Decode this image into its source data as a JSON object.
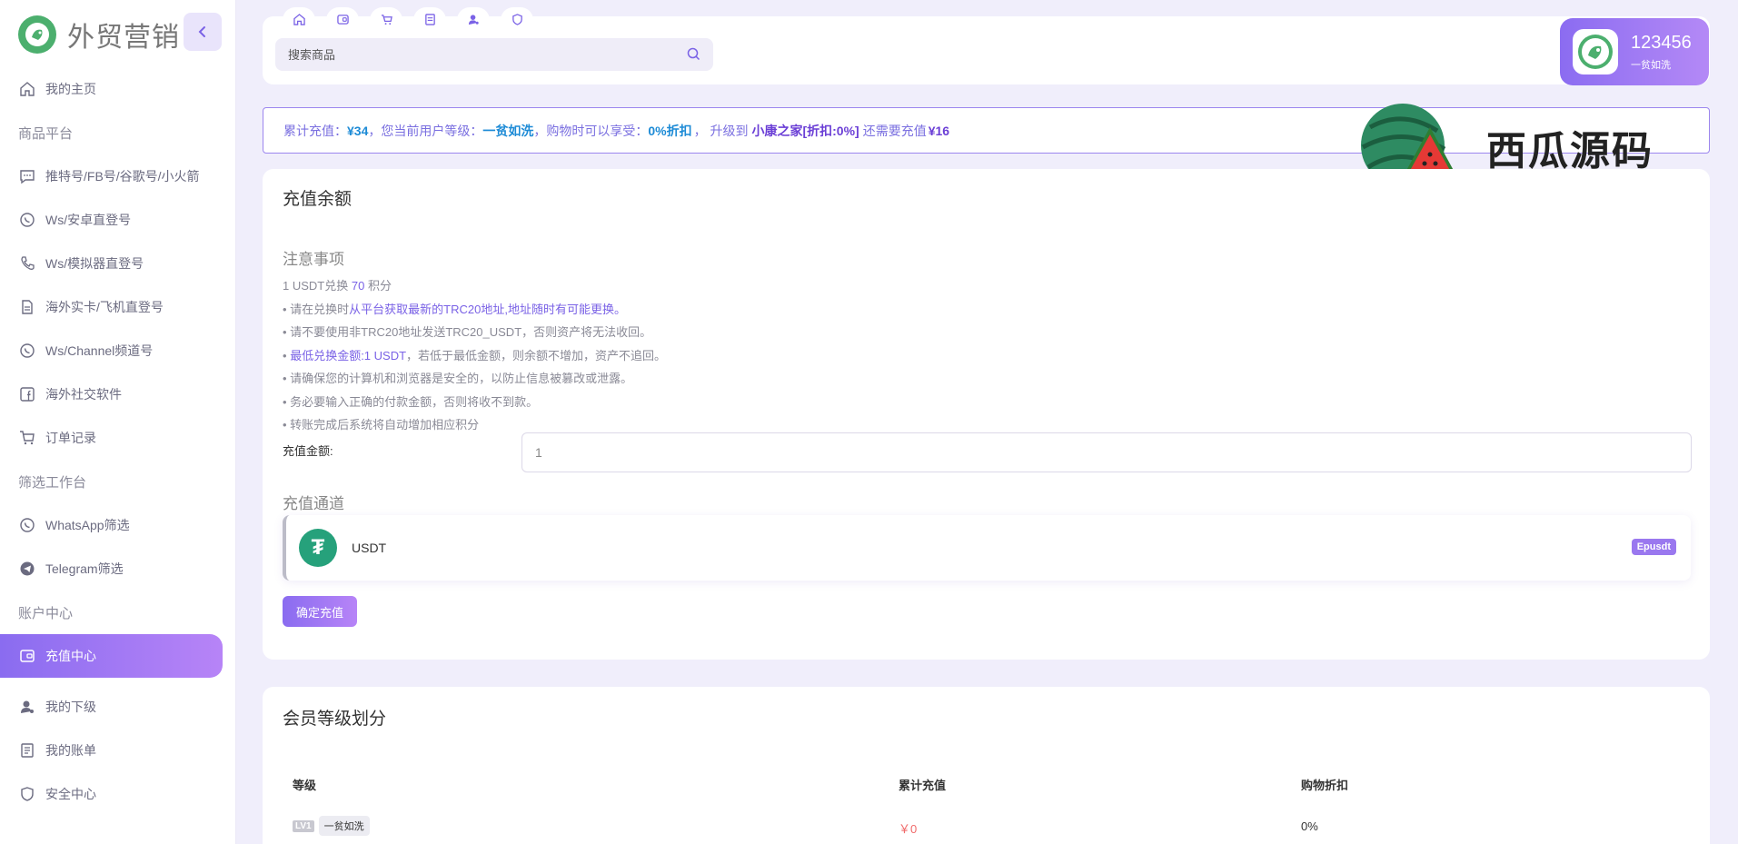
{
  "app": {
    "title": "外贸营销"
  },
  "sidebar": {
    "items": [
      {
        "type": "item",
        "label": "我的主页",
        "icon": "home-icon"
      },
      {
        "type": "section",
        "label": "商品平台"
      },
      {
        "type": "item",
        "label": "推特号/FB号/谷歌号/小火箭",
        "icon": "chat-icon"
      },
      {
        "type": "item",
        "label": "Ws/安卓直登号",
        "icon": "whatsapp-icon"
      },
      {
        "type": "item",
        "label": "Ws/模拟器直登号",
        "icon": "phone-icon"
      },
      {
        "type": "item",
        "label": "海外实卡/飞机直登号",
        "icon": "document-icon"
      },
      {
        "type": "item",
        "label": "Ws/Channel频道号",
        "icon": "whatsapp-icon"
      },
      {
        "type": "item",
        "label": "海外社交软件",
        "icon": "facebook-icon"
      },
      {
        "type": "item",
        "label": "订单记录",
        "icon": "cart-icon"
      },
      {
        "type": "section",
        "label": "筛选工作台"
      },
      {
        "type": "item",
        "label": "WhatsApp筛选",
        "icon": "whatsapp-icon"
      },
      {
        "type": "item",
        "label": "Telegram筛选",
        "icon": "telegram-icon"
      },
      {
        "type": "section",
        "label": "账户中心"
      },
      {
        "type": "item",
        "label": "充值中心",
        "icon": "wallet-icon",
        "active": true
      },
      {
        "type": "item",
        "label": "我的下级",
        "icon": "user-icon"
      },
      {
        "type": "item",
        "label": "我的账单",
        "icon": "bill-icon"
      },
      {
        "type": "item",
        "label": "安全中心",
        "icon": "shield-icon"
      }
    ]
  },
  "header": {
    "search_placeholder": "搜索商品",
    "user": {
      "name": "123456",
      "level": "一贫如洗"
    }
  },
  "notice": {
    "p1": "累计充值：",
    "total": "¥34",
    "p2": "，您当前用户等级：",
    "level": "一贫如洗",
    "p3": "，购物时可以享受：",
    "discount": "0%折扣",
    "p4": "， 升级到",
    "next_level": "小康之家[折扣:0%]",
    "p5": "还需要充值",
    "need": "¥16"
  },
  "watermark": {
    "text": "西瓜源码"
  },
  "recharge": {
    "title": "充值余额",
    "notes_title": "注意事项",
    "rate_prefix": "1 USDT兑换",
    "rate_value": "70",
    "rate_suffix": "积分",
    "note1_a": "• 请在兑换时",
    "note1_b": "从平台获取最新的TRC20地址,地址随时有可能更换。",
    "note2": "• 请不要使用非TRC20地址发送TRC20_USDT，否则资产将无法收回。",
    "note3_a": "•",
    "note3_b": "最低兑换金额:1 USDT",
    "note3_c": "，若低于最低金额，则余额不增加，资产不追回。",
    "note4": "• 请确保您的计算机和浏览器是安全的，以防止信息被篡改或泄露。",
    "note5": "• 务必要输入正确的付款金额，否则将收不到款。",
    "note6": "• 转账完成后系统将自动增加相应积分",
    "amount_label": "充值金额:",
    "amount_value": "1",
    "channel_title": "充值通道",
    "channel_name": "USDT",
    "channel_badge": "Epusdt",
    "confirm_label": "确定充值"
  },
  "levels": {
    "title": "会员等级划分",
    "headers": [
      "等级",
      "累计充值",
      "购物折扣"
    ],
    "rows": [
      {
        "badge": "LV1",
        "name": "一贫如洗",
        "recharge": "￥0",
        "discount": "0%"
      }
    ]
  }
}
